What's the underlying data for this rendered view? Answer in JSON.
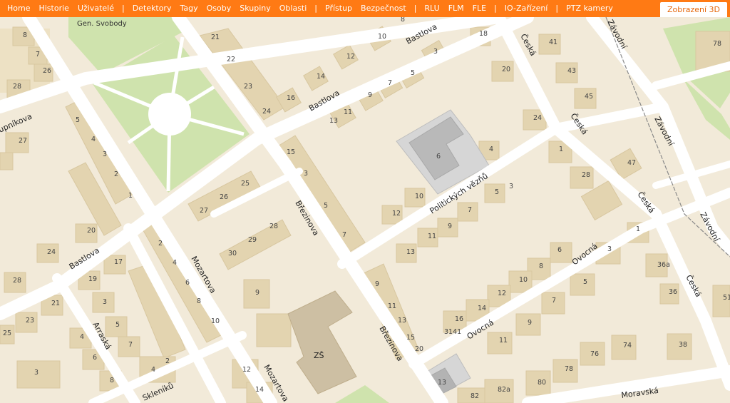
{
  "nav": {
    "items": [
      "Home",
      "Historie",
      "Uživatelé",
      "|",
      "Detektory",
      "Tagy",
      "Osoby",
      "Skupiny",
      "Oblasti",
      "|",
      "Přístup",
      "Bezpečnost",
      "|",
      "RLU",
      "FLM",
      "FLE",
      "|",
      "IO-Zařízení",
      "|",
      "PTZ kamery"
    ],
    "active": "Zobrazení 3D"
  },
  "map": {
    "colors": {
      "land": "#f2ead9",
      "block": "#ede1c4",
      "building": "#e3d4b0",
      "road": "#ffffff",
      "park": "#cfe3ad",
      "highlight": "#c9c9c9",
      "school": "#cfc2a6"
    },
    "places": {
      "park_name": "Gen. Svobody",
      "school": "ZŠ"
    },
    "streets": {
      "bastlova_top": "Bastlova",
      "bastlova_mid": "Bastlova",
      "bastlova_left": "Bastlova",
      "cerska_1": "Česká",
      "cerska_2": "Česká",
      "cerska_3": "Česká",
      "cerska_4": "Česká",
      "zavodni_1": "Závodní",
      "zavodni_2": "Závodní",
      "zavodni_3": "Závodní",
      "brezinova_1": "Březinova",
      "brezinova_2": "Březinova",
      "politickych": "Politických vězňů",
      "ovocna_1": "Ovocná",
      "ovocna_2": "Ovocná",
      "mozartova_1": "Mozartova",
      "mozartova_2": "Mozartova",
      "arraska": "Arraská",
      "skleniku": "Skleníků",
      "moravska": "Moravská",
      "kupnikova": "upníkova"
    },
    "numbers": [
      [
        "8",
        32,
        52
      ],
      [
        "7",
        50,
        79
      ],
      [
        "26",
        60,
        102
      ],
      [
        "28",
        18,
        124
      ],
      [
        "21",
        296,
        55
      ],
      [
        "22",
        318,
        86
      ],
      [
        "23",
        342,
        124
      ],
      [
        "24",
        368,
        159
      ],
      [
        "16",
        402,
        140
      ],
      [
        "14",
        444,
        110
      ],
      [
        "12",
        486,
        82
      ],
      [
        "10",
        530,
        54
      ],
      [
        "8",
        562,
        30
      ],
      [
        "18",
        672,
        50
      ],
      [
        "3",
        608,
        75
      ],
      [
        "5",
        576,
        105
      ],
      [
        "7",
        544,
        119
      ],
      [
        "9",
        516,
        136
      ],
      [
        "11",
        482,
        160
      ],
      [
        "13",
        462,
        172
      ],
      [
        "20",
        704,
        100
      ],
      [
        "41",
        770,
        62
      ],
      [
        "43",
        796,
        102
      ],
      [
        "45",
        820,
        138
      ],
      [
        "24",
        748,
        168
      ],
      [
        "6",
        612,
        222
      ],
      [
        "4",
        686,
        212
      ],
      [
        "1",
        784,
        212
      ],
      [
        "28",
        816,
        248
      ],
      [
        "47",
        880,
        231
      ],
      [
        "15",
        402,
        216
      ],
      [
        "3",
        426,
        246
      ],
      [
        "5",
        454,
        291
      ],
      [
        "7",
        480,
        332
      ],
      [
        "5",
        106,
        171
      ],
      [
        "4",
        128,
        198
      ],
      [
        "3",
        144,
        219
      ],
      [
        "2",
        160,
        247
      ],
      [
        "1",
        180,
        277
      ],
      [
        "27",
        26,
        200
      ],
      [
        "26",
        308,
        279
      ],
      [
        "25",
        338,
        260
      ],
      [
        "27",
        280,
        298
      ],
      [
        "20",
        122,
        326
      ],
      [
        "24",
        66,
        356
      ],
      [
        "28",
        18,
        396
      ],
      [
        "10",
        582,
        278
      ],
      [
        "12",
        550,
        302
      ],
      [
        "7",
        656,
        297
      ],
      [
        "5",
        694,
        272
      ],
      [
        "3",
        714,
        264
      ],
      [
        "9",
        628,
        320
      ],
      [
        "11",
        600,
        334
      ],
      [
        "13",
        570,
        356
      ],
      [
        "28",
        378,
        320
      ],
      [
        "29",
        348,
        339
      ],
      [
        "30",
        320,
        358
      ],
      [
        "2",
        222,
        344
      ],
      [
        "4",
        242,
        371
      ],
      [
        "6",
        260,
        399
      ],
      [
        "8",
        276,
        425
      ],
      [
        "10",
        296,
        453
      ],
      [
        "17",
        160,
        370
      ],
      [
        "19",
        124,
        394
      ],
      [
        "3",
        144,
        426
      ],
      [
        "5",
        162,
        458
      ],
      [
        "7",
        180,
        486
      ],
      [
        "6",
        130,
        504
      ],
      [
        "8",
        154,
        536
      ],
      [
        "21",
        72,
        428
      ],
      [
        "23",
        36,
        452
      ],
      [
        "4",
        112,
        475
      ],
      [
        "3",
        48,
        525
      ],
      [
        "25",
        4,
        470
      ],
      [
        "9",
        358,
        413
      ],
      [
        "1",
        892,
        324
      ],
      [
        "3",
        852,
        352
      ],
      [
        "6",
        782,
        353
      ],
      [
        "8",
        756,
        376
      ],
      [
        "10",
        728,
        395
      ],
      [
        "12",
        698,
        414
      ],
      [
        "14",
        670,
        435
      ],
      [
        "16",
        638,
        450
      ],
      [
        "5",
        818,
        398
      ],
      [
        "7",
        774,
        424
      ],
      [
        "9",
        740,
        455
      ],
      [
        "11",
        700,
        480
      ],
      [
        "9",
        526,
        401
      ],
      [
        "11",
        544,
        432
      ],
      [
        "13",
        558,
        452
      ],
      [
        "15",
        570,
        476
      ],
      [
        "20",
        582,
        492
      ],
      [
        "3141",
        623,
        468
      ],
      [
        "36a",
        922,
        374
      ],
      [
        "36",
        938,
        412
      ],
      [
        "51",
        1014,
        420
      ],
      [
        "38",
        952,
        486
      ],
      [
        "76",
        828,
        499
      ],
      [
        "74",
        874,
        487
      ],
      [
        "78",
        792,
        520
      ],
      [
        "80",
        754,
        539
      ],
      [
        "82",
        660,
        558
      ],
      [
        "82a",
        698,
        549
      ],
      [
        "13",
        614,
        539
      ],
      [
        "12",
        340,
        521
      ],
      [
        "14",
        358,
        549
      ],
      [
        "2",
        232,
        509
      ],
      [
        "4",
        212,
        521
      ],
      [
        "78",
        1000,
        64
      ]
    ]
  }
}
